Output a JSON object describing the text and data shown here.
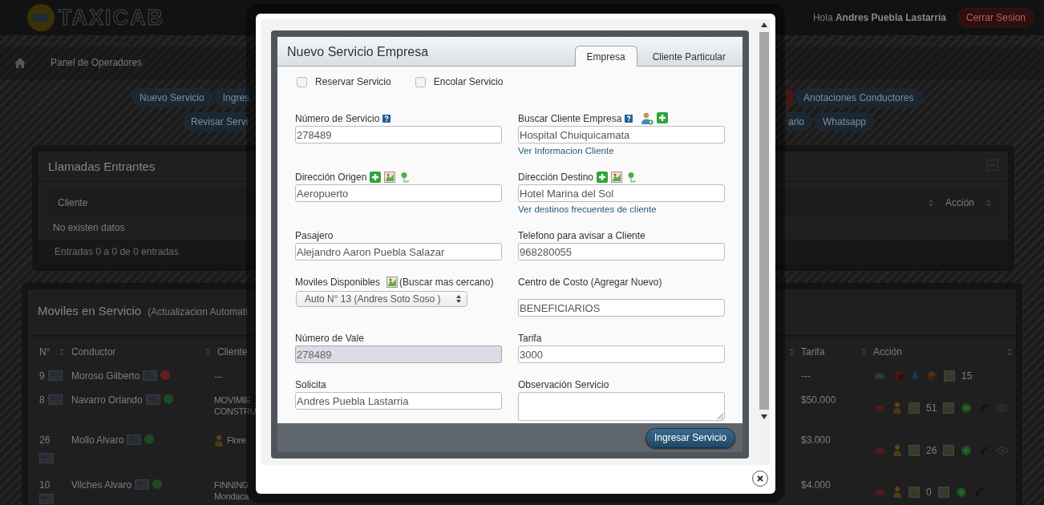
{
  "header": {
    "brand": "TAXICAB",
    "greeting": "Hola **Andres Puebla Lastarria**",
    "logout": "Cerrar Sesion"
  },
  "breadcrumb": {
    "page": "Panel de Operadores"
  },
  "nav_rows": [
    {
      "left": [
        {
          "kind": "normal",
          "label": "Nuevo Servicio"
        },
        {
          "kind": "cut",
          "label": "Ingres"
        }
      ],
      "right": [
        {
          "kind": "danger"
        },
        {
          "kind": "normal",
          "label": "Anotaciones Conductores"
        }
      ]
    },
    {
      "left": [
        {
          "kind": "cut",
          "label": "Revisar Servi"
        }
      ],
      "right": [
        {
          "kind": "cut",
          "label": "ario"
        },
        {
          "kind": "normal",
          "label": "Whatsapp"
        }
      ]
    }
  ],
  "calls_panel": {
    "title": "Llamadas Entrantes",
    "columns": [
      "Cliente",
      "Acción"
    ],
    "empty_text": "No existen datos",
    "footer": "Entradas 0 a 0 de 0 entradas"
  },
  "vehicles_panel": {
    "title": "Moviles en Servicio",
    "subtitle": "(Actualizacion Automati",
    "columns": [
      "N°",
      "Conductor",
      "Cliente",
      "Tarifa",
      "Acción"
    ],
    "rows": [
      {
        "kind": "free",
        "number": "9",
        "driver": "Moroso Gilberto",
        "color": "#6a1d1d",
        "client": [
          "---"
        ],
        "client_icon": false,
        "fare": "---",
        "count": "15",
        "watch": false
      },
      {
        "kind": "busy",
        "number": "8",
        "driver": "Navarro Orlando",
        "color": "#1d4a26",
        "client": [
          "MOVIMIE",
          "CONSTRU"
        ],
        "client_icon": false,
        "fare": "$50.000",
        "count": "51",
        "watch": true
      },
      {
        "kind": "busy",
        "number": "26",
        "driver": "Mollo Alvaro",
        "color": "#1d4a26",
        "client": [
          "Flore"
        ],
        "client_icon": true,
        "fare": "$3.000",
        "count": "26",
        "watch": true
      },
      {
        "kind": "busy",
        "number": "10",
        "driver": "Vilches Alvaro",
        "color": "#1d4a26",
        "client": [
          "FINNING",
          "Mondaca"
        ],
        "client_icon": false,
        "fare": "$4.000",
        "count": "0",
        "watch": false
      }
    ]
  },
  "modal": {
    "title": "Nuevo Servicio Empresa",
    "tabs": [
      {
        "label": "Empresa",
        "selected": true
      },
      {
        "label": "Cliente Particular",
        "selected": false
      }
    ],
    "options": [
      {
        "label": "Reservar Servicio",
        "checked": false
      },
      {
        "label": "Encolar Servicio",
        "checked": false
      }
    ],
    "fields": [
      {
        "kind": "text",
        "label": "Número de Servicio",
        "help": true,
        "disabled": false,
        "value": "278489"
      },
      {
        "kind": "client-search",
        "label": "Buscar Cliente Empresa",
        "help": true,
        "disabled": false,
        "value": "Hospital Chuiquicamata",
        "link": "Ver Informacion Cliente"
      },
      {
        "kind": "address",
        "label": "Dirección Origen",
        "help": false,
        "disabled": false,
        "value": "Aeropuerto"
      },
      {
        "kind": "address",
        "label": "Dirección Destino",
        "help": false,
        "disabled": false,
        "value": "Hotel Marina del Sol",
        "link": "Ver destinos frecuentes de cliente"
      },
      {
        "kind": "text",
        "label": "Pasajero",
        "help": false,
        "disabled": false,
        "value": "Alejandro Aaron Puebla Salazar"
      },
      {
        "kind": "text",
        "label": "Telefono para avisar a Cliente",
        "help": false,
        "disabled": false,
        "value": "968280055"
      },
      {
        "kind": "vehicle-select",
        "label": "Moviles Disponibles",
        "help": false,
        "disabled": false,
        "note": "(Buscar mas cercano)",
        "value": "Auto N° 13 (Andres Soto Soso )"
      },
      {
        "kind": "spaced-text",
        "label": "Centro de Costo (Agregar Nuevo)",
        "help": false,
        "disabled": false,
        "value": "BENEFICIARIOS"
      },
      {
        "kind": "text",
        "label": "Número de Vale",
        "help": false,
        "disabled": true,
        "value": "278489"
      },
      {
        "kind": "text",
        "label": "Tarifa",
        "help": false,
        "disabled": false,
        "value": "3000"
      },
      {
        "kind": "text",
        "label": "Solicita",
        "help": false,
        "disabled": false,
        "value": "Andres Puebla Lastarria"
      },
      {
        "kind": "textarea",
        "label": "Observación Servicio",
        "help": false,
        "disabled": false
      }
    ],
    "submit": "Ingresar Servicio"
  }
}
